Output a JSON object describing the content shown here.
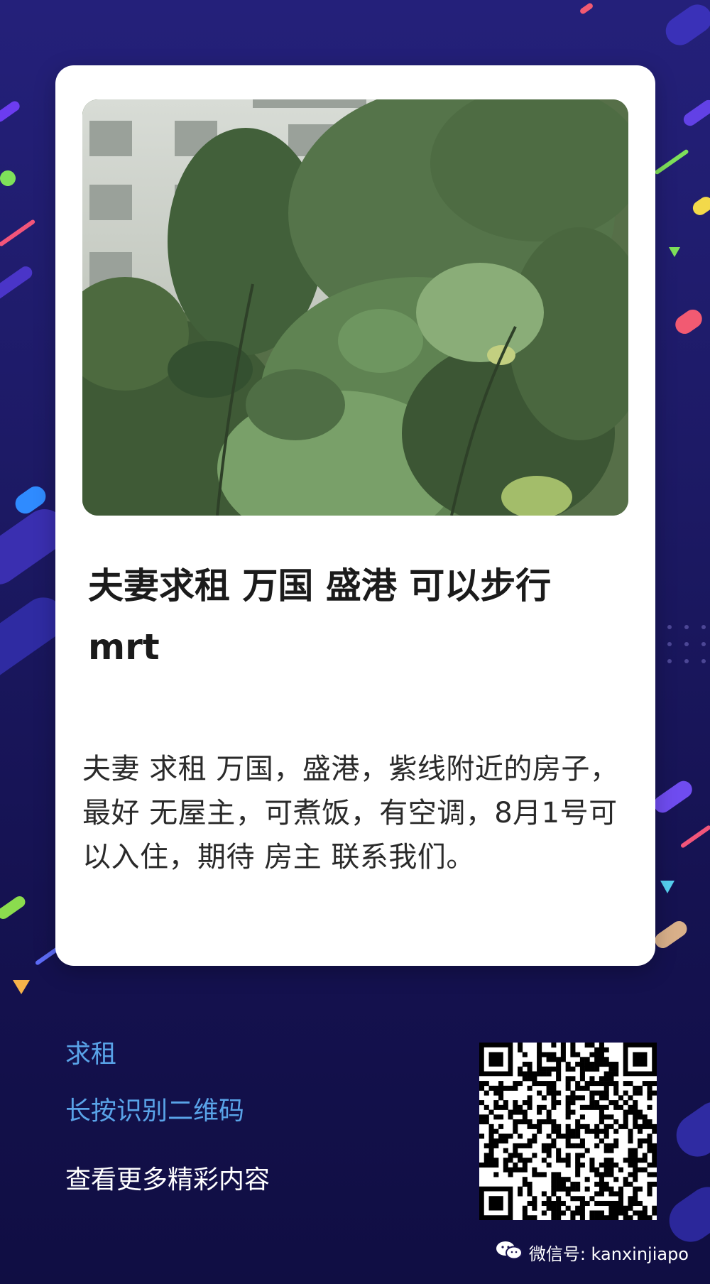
{
  "post": {
    "title": "夫妻求租 万国 盛港 可以步行 mrt",
    "body": "夫妻 求租 万国，盛港，紫线附近的房子，最好 无屋主，可煮饭，有空调，8月1号可以入住，期待 房主 联系我们。"
  },
  "footer": {
    "category_link": "求租",
    "qr_hint": "长按识别二维码",
    "more_text": "查看更多精彩内容"
  },
  "watermark": {
    "text": "微信号: kanxinjiapo",
    "icon": "wechat-icon"
  },
  "colors": {
    "background": "#1d1a66",
    "card": "#ffffff",
    "link": "#59a3e8",
    "title": "#1b1b1b"
  }
}
